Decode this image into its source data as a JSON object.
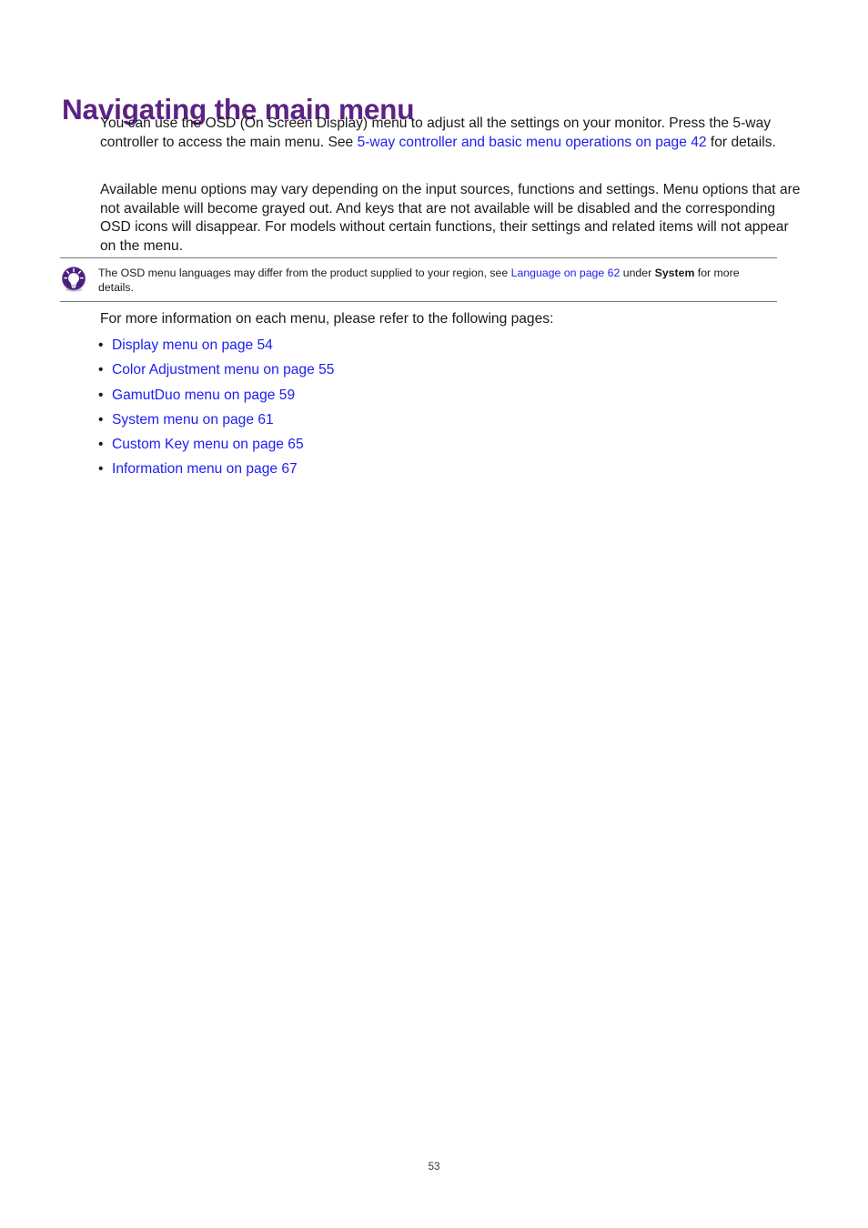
{
  "document": {
    "title": "Navigating the main menu",
    "page_number": "53",
    "accent_color": "#5b2382",
    "link_color": "#1d1df0",
    "rule_color": "#7a7a7a"
  },
  "paragraphs": {
    "intro": {
      "text_before_link": "You can use the OSD (On Screen Display) menu to adjust all the settings on your monitor. Press the 5-way controller to access the main menu. See ",
      "link_text": "5-way controller and basic menu operations on page 42",
      "text_after_link": " for details."
    },
    "availability": {
      "text": "Available menu options may vary depending on the input sources, functions and settings. Menu options that are not available will become grayed out. And keys that are not available will be disabled and the corresponding OSD icons will disappear. For models without certain functions, their settings and related items will not appear on the menu."
    }
  },
  "tip": {
    "icon": "lightbulb-tip-icon",
    "text_before_link": "The OSD menu languages may differ from the product supplied to your region, see ",
    "link_text": "Language on page 62",
    "text_middle": " under ",
    "bold_term": "System",
    "text_after": " for more details."
  },
  "list_section": {
    "lead_in": "For more information on each menu, please refer to the following pages:",
    "bullet_char": "•",
    "items": [
      {
        "label": "Display menu on page 54"
      },
      {
        "label": "Color Adjustment menu on page 55"
      },
      {
        "label": "GamutDuo menu on page 59"
      },
      {
        "label": "System menu on page 61"
      },
      {
        "label": "Custom Key menu on page 65"
      },
      {
        "label": "Information menu on page 67"
      }
    ]
  }
}
